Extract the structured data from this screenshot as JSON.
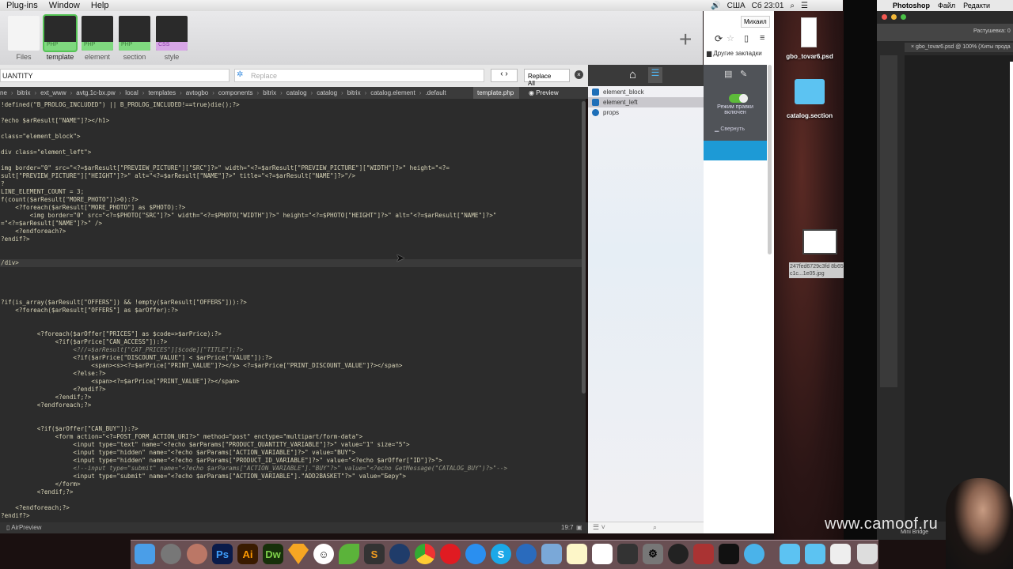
{
  "menubar": {
    "items": [
      "Plug-ins",
      "Window",
      "Help"
    ],
    "status": {
      "layout": "США",
      "clock": "Сб 23:01"
    }
  },
  "file_tabs": [
    {
      "name": "Files",
      "type": ""
    },
    {
      "name": "template",
      "type": "PHP"
    },
    {
      "name": "element",
      "type": "PHP"
    },
    {
      "name": "section",
      "type": "PHP"
    },
    {
      "name": "style",
      "type": "CSS"
    }
  ],
  "find": {
    "value": "UANTITY",
    "replace_placeholder": "Replace",
    "replace_btn": "Replace",
    "all_btn": "All"
  },
  "breadcrumb": [
    "ne",
    "bitrix",
    "ext_www",
    "avtg.1c-bx.pw",
    "local",
    "templates",
    "avtogbo",
    "components",
    "bitrix",
    "catalog",
    "catalog",
    "bitrix",
    "catalog.element",
    ".default"
  ],
  "current_file": "template.php",
  "preview_label": "Preview",
  "code_lines": [
    "!defined(\"B_PROLOG_INCLUDED\") || B_PROLOG_INCLUDED!==true)die();?>",
    "",
    "?echo $arResult[\"NAME\"]?></h1>",
    "",
    "class=\"element_block\">",
    "",
    "div class=\"element_left\">",
    "",
    "img border=\"0\" src=\"<?=$arResult[\"PREVIEW_PICTURE\"][\"SRC\"]?>\" width=\"<?=$arResult[\"PREVIEW_PICTURE\"][\"WIDTH\"]?>\" height=\"<?=",
    "sult[\"PREVIEW_PICTURE\"][\"HEIGHT\"]?>\" alt=\"<?=$arResult[\"NAME\"]?>\" title=\"<?=$arResult[\"NAME\"]?>\"/>",
    "?",
    "LINE_ELEMENT_COUNT = 3;",
    "f(count($arResult[\"MORE_PHOTO\"])>0):?>",
    "    <?foreach($arResult[\"MORE_PHOTO\"] as $PHOTO):?>",
    "        <img border=\"0\" src=\"<?=$PHOTO[\"SRC\"]?>\" width=\"<?=$PHOTO[\"WIDTH\"]?>\" height=\"<?=$PHOTO[\"HEIGHT\"]?>\" alt=\"<?=$arResult[\"NAME\"]?>\"",
    "=\"<?=$arResult[\"NAME\"]?>\" />",
    "    <?endforeach?>",
    "?endif?>",
    "",
    "",
    "/div>",
    "",
    "",
    "",
    "",
    "?if(is_array($arResult[\"OFFERS\"]) && !empty($arResult[\"OFFERS\"])):?>",
    "    <?foreach($arResult[\"OFFERS\"] as $arOffer):?>",
    "",
    "",
    "          <?foreach($arOffer[\"PRICES\"] as $code=>$arPrice):?>",
    "               <?if($arPrice[\"CAN_ACCESS\"]):?>",
    "                    <?//=$arResult[\"CAT_PRICES\"][$code][\"TITLE\"];?>",
    "                    <?if($arPrice[\"DISCOUNT_VALUE\"] < $arPrice[\"VALUE\"]):?>",
    "                         <span><s><?=$arPrice[\"PRINT_VALUE\"]?></s> <?=$arPrice[\"PRINT_DISCOUNT_VALUE\"]?></span>",
    "                    <?else:?>",
    "                         <span><?=$arPrice[\"PRINT_VALUE\"]?></span>",
    "                    <?endif?>",
    "               <?endif;?>",
    "          <?endforeach;?>",
    "",
    "",
    "          <?if($arOffer[\"CAN_BUY\"]):?>",
    "               <form action=\"<?=POST_FORM_ACTION_URI?>\" method=\"post\" enctype=\"multipart/form-data\">",
    "                    <input type=\"text\" name=\"<?echo $arParams[\"PRODUCT_QUANTITY_VARIABLE\"]?>\" value=\"1\" size=\"5\">",
    "                    <input type=\"hidden\" name=\"<?echo $arParams[\"ACTION_VARIABLE\"]?>\" value=\"BUY\">",
    "                    <input type=\"hidden\" name=\"<?echo $arParams[\"PRODUCT_ID_VARIABLE\"]?>\" value=\"<?echo $arOffer[\"ID\"]?>\">",
    "                    <!--input type=\"submit\" name=\"<?echo $arParams[\"ACTION_VARIABLE\"].\"BUY\"?>\" value=\"<?echo GetMessage(\"CATALOG_BUY\")?>\"-->",
    "                    <input type=\"submit\" name=\"<?echo $arParams[\"ACTION_VARIABLE\"].\"ADD2BASKET\"?>\" value=\"Беру\">",
    "               </form>",
    "          <?endif;?>",
    "",
    "    <?endforeach;?>",
    "?endif?>"
  ],
  "statusbar": {
    "label": "AirPreview",
    "position": "19:7"
  },
  "side_panel": {
    "items": [
      "element_block",
      "element_left",
      "props"
    ],
    "selected": 1
  },
  "browser": {
    "user": "Михаил",
    "bookmarks": "Другие закладки",
    "edit_mode": "Режим правки включен",
    "collapse": "Свернуть"
  },
  "desktop": {
    "files": [
      "gbo_tovar6.psd",
      "catalog.section",
      "247fed6729c3fd 8b65c1c...1e05.jpg"
    ]
  },
  "photoshop": {
    "app": "Photoshop",
    "menu": [
      "Файл",
      "Редакти"
    ],
    "doc_tab": "gbo_tovar6.psd @ 100% (Хиты прода",
    "feather_label": "Растушевка:",
    "feather_value": "0",
    "mini_bridge": "Mini Bridge"
  },
  "dock": [
    "Ps",
    "Ai",
    "Dw",
    "S"
  ],
  "watermark": "www.camoof.ru",
  "colors": {
    "editor_bg": "#2c2c2c",
    "accent_blue": "#1d9ad6",
    "php_tab": "#7fd97f",
    "css_tab": "#d7a6e6"
  }
}
